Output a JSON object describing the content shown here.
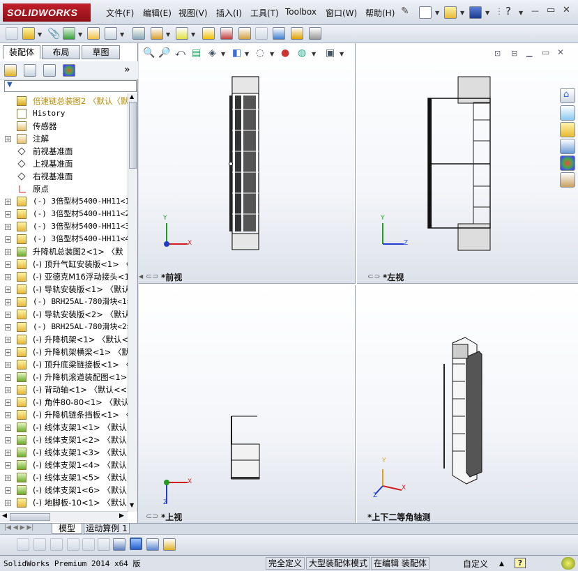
{
  "app": {
    "logo_text": "SOLIDWORKS",
    "menu": [
      "文件(F)",
      "编辑(E)",
      "视图(V)",
      "插入(I)",
      "工具(T)",
      "Toolbox",
      "窗口(W)",
      "帮助(H)"
    ],
    "window_controls": {
      "question": "?",
      "minimize": "—",
      "restore": "▭",
      "close": "✕"
    }
  },
  "feature_manager": {
    "tabs": [
      "装配体",
      "布局",
      "草图"
    ],
    "expand_button": "»",
    "filter_icon": "▼",
    "tree": [
      {
        "label": "倍速链总装图2  〈默认〈默",
        "kind": "assembly-root",
        "expandable": false,
        "color": "#b48a00"
      },
      {
        "label": "History",
        "kind": "history",
        "expandable": false,
        "mono": true
      },
      {
        "label": "传感器",
        "kind": "sensor",
        "expandable": false
      },
      {
        "label": "注解",
        "kind": "annotation",
        "expandable": true
      },
      {
        "label": "前视基准面",
        "kind": "plane",
        "expandable": false
      },
      {
        "label": "上视基准面",
        "kind": "plane",
        "expandable": false
      },
      {
        "label": "右视基准面",
        "kind": "plane",
        "expandable": false
      },
      {
        "label": "原点",
        "kind": "origin",
        "expandable": false
      },
      {
        "label": "(-) 3倍型材5400-HH11<1>",
        "kind": "part",
        "expandable": true,
        "mono": true
      },
      {
        "label": "(-) 3倍型材5400-HH11<2>",
        "kind": "part",
        "expandable": true,
        "mono": true
      },
      {
        "label": "(-) 3倍型材5400-HH11<3>",
        "kind": "part",
        "expandable": true,
        "mono": true
      },
      {
        "label": "(-) 3倍型材5400-HH11<4>",
        "kind": "part",
        "expandable": true,
        "mono": true
      },
      {
        "label": "升降机总装图2<1> 〈默",
        "kind": "subassembly",
        "expandable": true
      },
      {
        "label": "(-) 顶升气缸安装版<1> 〈",
        "kind": "part",
        "expandable": true
      },
      {
        "label": "(-) 亚德克M16浮动接头<1",
        "kind": "part",
        "expandable": true
      },
      {
        "label": "(-) 导轨安装版<1> 〈默认",
        "kind": "part",
        "expandable": true
      },
      {
        "label": "(-) BRH25AL-780滑块<1>",
        "kind": "part",
        "expandable": true,
        "mono": true
      },
      {
        "label": "(-) 导轨安装版<2> 〈默认",
        "kind": "part",
        "expandable": true
      },
      {
        "label": "(-) BRH25AL-780滑块<2>",
        "kind": "part",
        "expandable": true,
        "mono": true
      },
      {
        "label": "(-) 升降机架<1> 〈默认<<",
        "kind": "part",
        "expandable": true
      },
      {
        "label": "(-) 升降机架横梁<1> 〈默",
        "kind": "part",
        "expandable": true
      },
      {
        "label": "(-) 顶升底梁链接板<1> 〈",
        "kind": "part",
        "expandable": true
      },
      {
        "label": "(-) 升降机滚道装配图<1>",
        "kind": "subassembly",
        "expandable": true
      },
      {
        "label": "(-) 背动轴<1> 〈默认<<默",
        "kind": "part",
        "expandable": true
      },
      {
        "label": "(-) 角件80-80<1> 〈默认<",
        "kind": "part",
        "expandable": true
      },
      {
        "label": "(-) 升降机链条挡板<1> 〈",
        "kind": "part",
        "expandable": true
      },
      {
        "label": "(-) 线体支架1<1> 〈默认<",
        "kind": "subassembly",
        "expandable": true
      },
      {
        "label": "(-) 线体支架1<2> 〈默认<",
        "kind": "subassembly",
        "expandable": true
      },
      {
        "label": "(-) 线体支架1<3> 〈默认<",
        "kind": "subassembly",
        "expandable": true
      },
      {
        "label": "(-) 线体支架1<4> 〈默认<",
        "kind": "subassembly",
        "expandable": true
      },
      {
        "label": "(-) 线体支架1<5> 〈默认<",
        "kind": "subassembly",
        "expandable": true
      },
      {
        "label": "(-) 线体支架1<6> 〈默认<",
        "kind": "subassembly",
        "expandable": true
      },
      {
        "label": "(-) 地脚板-10<1> 〈默认<",
        "kind": "part",
        "expandable": true
      }
    ]
  },
  "viewports": {
    "front": "*前视",
    "left": "*左视",
    "top": "*上视",
    "iso": "*上下二等角轴测",
    "axis": {
      "x": "X",
      "y": "Y",
      "z": "Z"
    }
  },
  "bottom_tabs": [
    "模型",
    "运动算例 1"
  ],
  "status_bar": {
    "version": "SolidWorks Premium 2014 x64 版",
    "fully_defined": "完全定义",
    "large_assembly": "大型装配体模式",
    "editing": "在编辑 装配体",
    "custom": "自定义",
    "arrow": "▲",
    "help": "?"
  },
  "colors": {
    "brand_red": "#b3151f",
    "axis_x": "#d21d1d",
    "axis_y": "#1f9b1f",
    "axis_z": "#1f3bd2"
  }
}
